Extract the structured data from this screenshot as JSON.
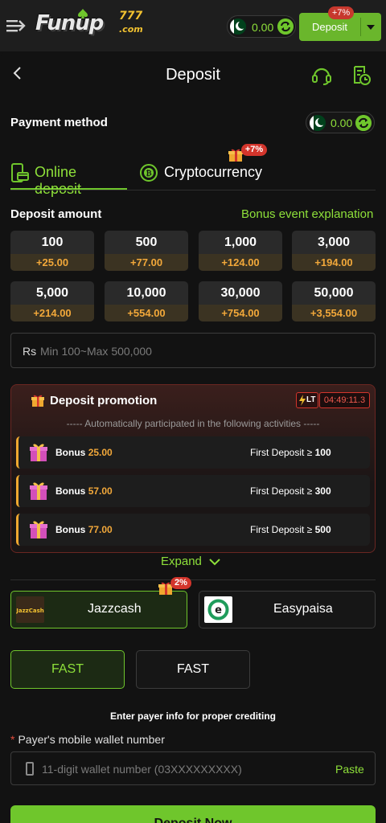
{
  "header": {
    "logo_text": "Funup",
    "logo_number": "777",
    "logo_domain": ".com",
    "balance": "0.00",
    "deposit_label": "Deposit",
    "deposit_bonus_badge": "+7%"
  },
  "page": {
    "title": "Deposit"
  },
  "payment_method": {
    "label": "Payment method",
    "balance": "0.00",
    "tabs": [
      {
        "label": "Online deposit",
        "active": true
      },
      {
        "label": "Cryptocurrency",
        "active": false,
        "badge": "+7%"
      }
    ]
  },
  "deposit_amount": {
    "label": "Deposit amount",
    "bonus_link": "Bonus event explanation",
    "options": [
      {
        "amount": "100",
        "bonus": "+25.00"
      },
      {
        "amount": "500",
        "bonus": "+77.00"
      },
      {
        "amount": "1,000",
        "bonus": "+124.00"
      },
      {
        "amount": "3,000",
        "bonus": "+194.00"
      },
      {
        "amount": "5,000",
        "bonus": "+214.00"
      },
      {
        "amount": "10,000",
        "bonus": "+554.00"
      },
      {
        "amount": "30,000",
        "bonus": "+754.00"
      },
      {
        "amount": "50,000",
        "bonus": "+3,554.00"
      }
    ],
    "currency": "Rs",
    "placeholder": "Min 100~Max 500,000"
  },
  "promotion": {
    "title": "Deposit promotion",
    "lt_label": "LT",
    "timer": "04:49:11.3",
    "subtitle": "----- Automatically participated in the following activities -----",
    "rows": [
      {
        "bonus_label": "Bonus",
        "bonus_value": "25.00",
        "condition": "First Deposit ≥",
        "threshold": "100"
      },
      {
        "bonus_label": "Bonus",
        "bonus_value": "57.00",
        "condition": "First Deposit ≥",
        "threshold": "300"
      },
      {
        "bonus_label": "Bonus",
        "bonus_value": "77.00",
        "condition": "First Deposit ≥",
        "threshold": "500"
      }
    ],
    "expand_label": "Expand"
  },
  "channels": [
    {
      "label": "Jazzcash",
      "logo_text": "JazzCash",
      "badge": "2%",
      "selected": true
    },
    {
      "label": "Easypaisa",
      "logo_text": "e",
      "selected": false
    }
  ],
  "speeds": [
    {
      "label": "FAST",
      "selected": true
    },
    {
      "label": "FAST",
      "selected": false
    }
  ],
  "payer": {
    "info": "Enter payer info for proper crediting",
    "wallet_label": "Payer's mobile wallet number",
    "required_mark": "*",
    "wallet_placeholder": "11-digit wallet number (03XXXXXXXXX)",
    "paste_label": "Paste"
  },
  "submit_label": "Deposit Now",
  "colors": {
    "accent": "#6fc62c",
    "bonus": "#f2a83a",
    "danger": "#d3352c",
    "background": "#121212"
  }
}
